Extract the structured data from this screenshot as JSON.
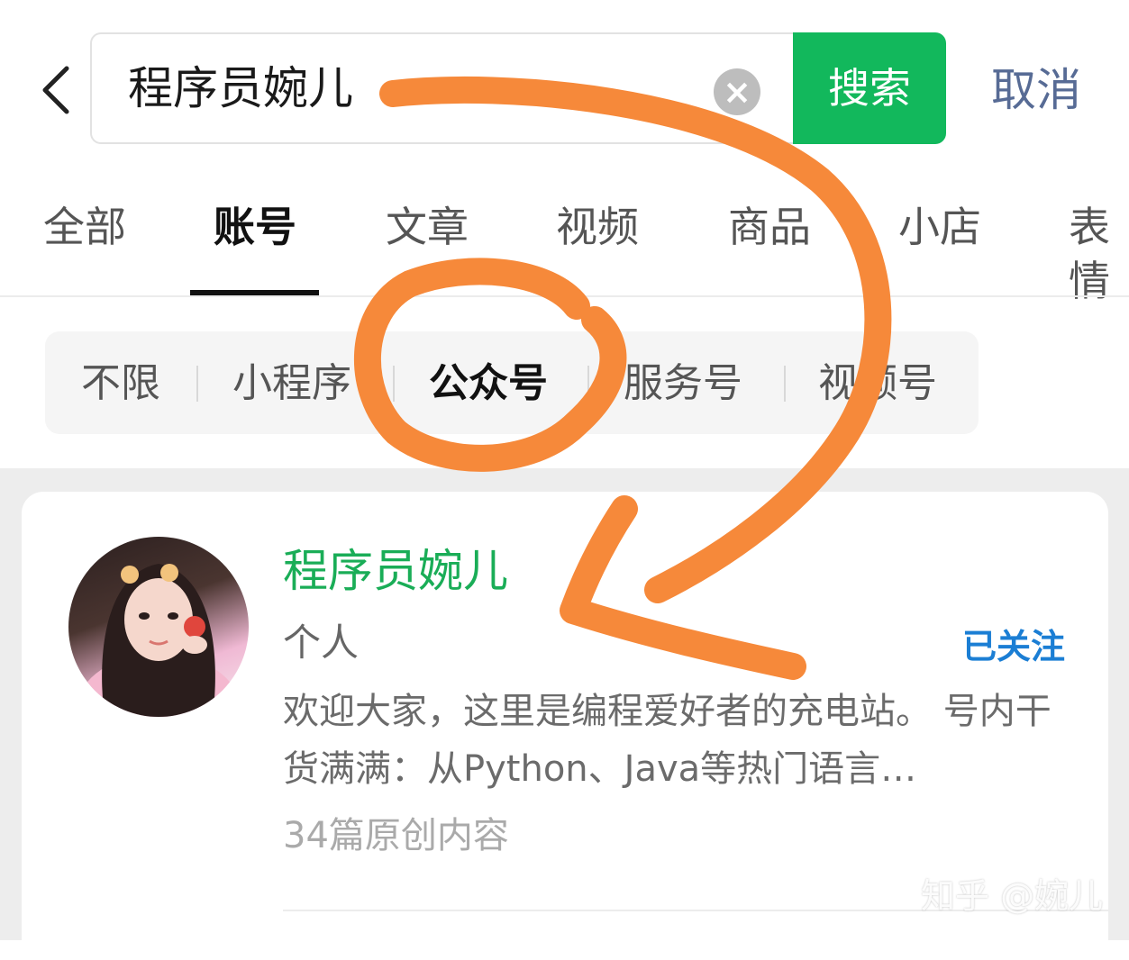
{
  "search": {
    "value": "程序员婉儿",
    "clear_symbol": "×",
    "submit_label": "搜索",
    "cancel_label": "取消"
  },
  "tabs": [
    {
      "label": "全部"
    },
    {
      "label": "账号",
      "selected": true
    },
    {
      "label": "文章"
    },
    {
      "label": "视频"
    },
    {
      "label": "商品"
    },
    {
      "label": "小店"
    },
    {
      "label": "表情"
    }
  ],
  "filters": [
    {
      "label": "不限"
    },
    {
      "label": "小程序"
    },
    {
      "label": "公众号",
      "selected": true
    },
    {
      "label": "服务号"
    },
    {
      "label": "视频号"
    }
  ],
  "result": {
    "name": "程序员婉儿",
    "type": "个人",
    "follow_status": "已关注",
    "description": "欢迎大家，这里是编程爱好者的充电站。 号内干货满满：从Python、Java等热门语言…",
    "count": "34篇原创内容"
  },
  "watermark": "知乎 @婉儿",
  "colors": {
    "accent_green": "#12b85c",
    "name_green": "#1aad57",
    "link_blue": "#576b95",
    "follow_blue": "#1b7ed4",
    "annotation_orange": "#f6893a"
  },
  "icons": {
    "back": "chevron-left-icon",
    "clear": "clear-icon"
  }
}
